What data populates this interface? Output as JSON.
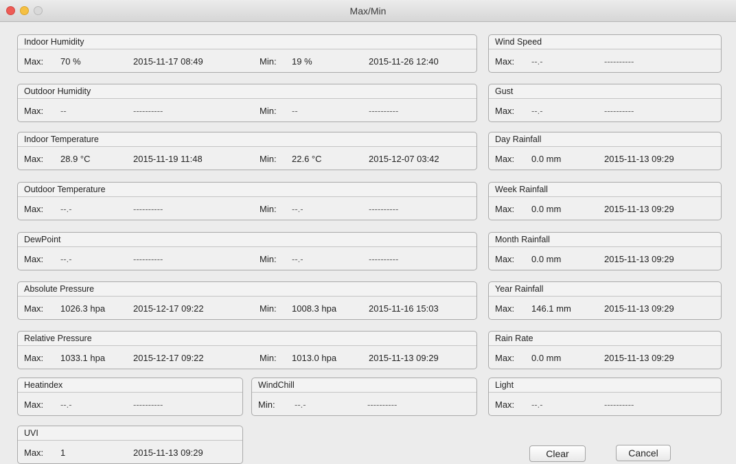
{
  "window": {
    "title": "Max/Min"
  },
  "labels": {
    "max": "Max:",
    "min": "Min:"
  },
  "panels": {
    "indoor_humidity": {
      "title": "Indoor Humidity",
      "max_value": "70 %",
      "max_time": "2015-11-17 08:49",
      "min_value": "19 %",
      "min_time": "2015-11-26 12:40"
    },
    "outdoor_humidity": {
      "title": "Outdoor Humidity",
      "max_value": "--",
      "max_time": "----------",
      "min_value": "--",
      "min_time": "----------"
    },
    "indoor_temperature": {
      "title": "Indoor Temperature",
      "max_value": "28.9 °C",
      "max_time": "2015-11-19 11:48",
      "min_value": "22.6 °C",
      "min_time": "2015-12-07 03:42"
    },
    "outdoor_temperature": {
      "title": "Outdoor Temperature",
      "max_value": "--.-",
      "max_time": "----------",
      "min_value": "--.-",
      "min_time": "----------"
    },
    "dewpoint": {
      "title": "DewPoint",
      "max_value": "--.-",
      "max_time": "----------",
      "min_value": "--.-",
      "min_time": "----------"
    },
    "absolute_pressure": {
      "title": "Absolute Pressure",
      "max_value": "1026.3 hpa",
      "max_time": "2015-12-17 09:22",
      "min_value": "1008.3 hpa",
      "min_time": "2015-11-16 15:03"
    },
    "relative_pressure": {
      "title": "Relative Pressure",
      "max_value": "1033.1 hpa",
      "max_time": "2015-12-17 09:22",
      "min_value": "1013.0 hpa",
      "min_time": "2015-11-13 09:29"
    },
    "heatindex": {
      "title": "Heatindex",
      "max_value": "--.-",
      "max_time": "----------"
    },
    "windchill": {
      "title": "WindChill",
      "min_value": "--.-",
      "min_time": "----------"
    },
    "uvi": {
      "title": "UVI",
      "max_value": "1",
      "max_time": "2015-11-13 09:29"
    },
    "wind_speed": {
      "title": "Wind Speed",
      "max_value": "--.-",
      "max_time": "----------"
    },
    "gust": {
      "title": "Gust",
      "max_value": "--.-",
      "max_time": "----------"
    },
    "day_rainfall": {
      "title": "Day Rainfall",
      "max_value": "0.0 mm",
      "max_time": "2015-11-13 09:29"
    },
    "week_rainfall": {
      "title": "Week Rainfall",
      "max_value": "0.0 mm",
      "max_time": "2015-11-13 09:29"
    },
    "month_rainfall": {
      "title": "Month Rainfall",
      "max_value": "0.0 mm",
      "max_time": "2015-11-13 09:29"
    },
    "year_rainfall": {
      "title": "Year Rainfall",
      "max_value": "146.1 mm",
      "max_time": "2015-11-13 09:29"
    },
    "rain_rate": {
      "title": "Rain Rate",
      "max_value": "0.0 mm",
      "max_time": "2015-11-13 09:29"
    },
    "light": {
      "title": "Light",
      "max_value": "--.-",
      "max_time": "----------"
    }
  },
  "buttons": {
    "clear": "Clear",
    "cancel": "Cancel"
  }
}
